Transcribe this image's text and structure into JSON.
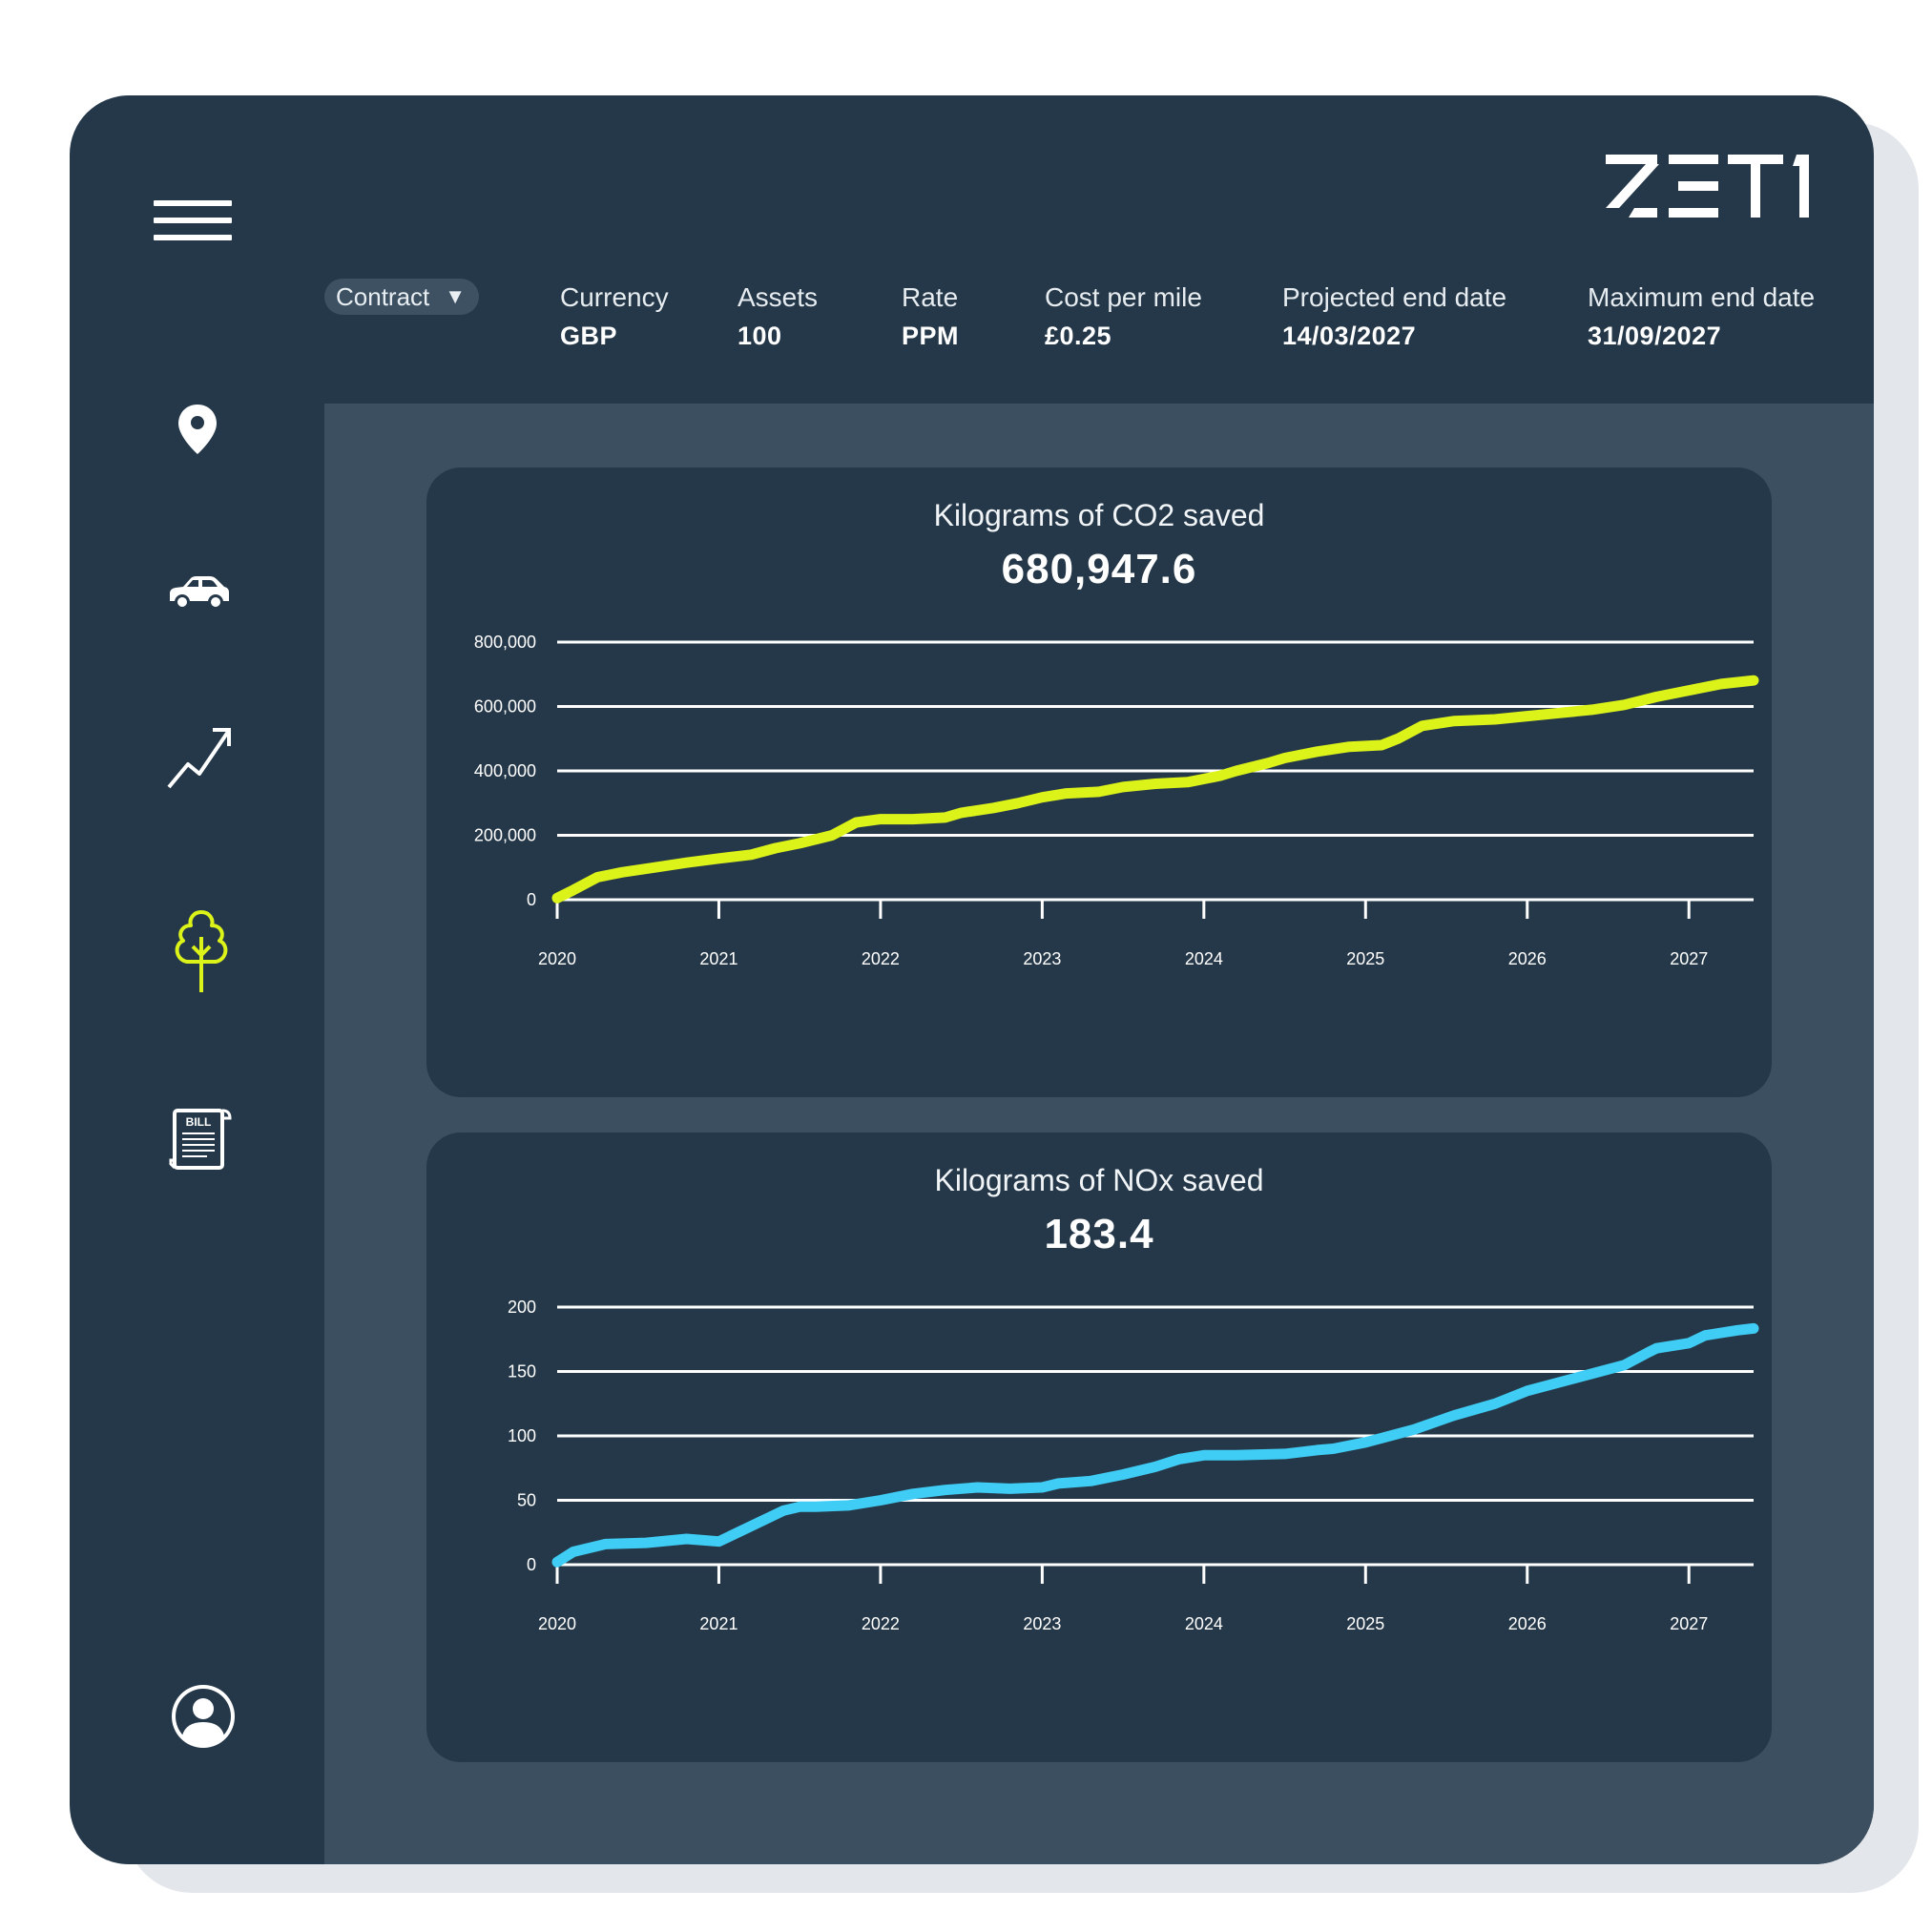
{
  "brand": {
    "logo_text": "ZETI"
  },
  "sidebar": {
    "items": [
      {
        "icon": "location-pin-icon",
        "active": false
      },
      {
        "icon": "car-icon",
        "active": false
      },
      {
        "icon": "trend-up-icon",
        "active": false
      },
      {
        "icon": "tree-icon",
        "active": true
      },
      {
        "icon": "bill-icon",
        "active": false
      }
    ],
    "profile_icon": "user-profile-icon"
  },
  "header": {
    "contract_dropdown": {
      "label": "Contract"
    },
    "stats": [
      {
        "label": "Currency",
        "value": "GBP"
      },
      {
        "label": "Assets",
        "value": "100"
      },
      {
        "label": "Rate",
        "value": "PPM"
      },
      {
        "label": "Cost per mile",
        "value": "£0.25"
      },
      {
        "label": "Projected end date",
        "value": "14/03/2027"
      },
      {
        "label": "Maximum end date",
        "value": "31/09/2027"
      }
    ]
  },
  "colors": {
    "background": "#253849",
    "content": "#3b4f60",
    "co2_line": "#dcf31a",
    "nox_line": "#3fcdf5"
  },
  "chart_data": [
    {
      "type": "line",
      "title": "Kilograms of CO2 saved",
      "total": "680,947.6",
      "x_ticks": [
        "2020",
        "2021",
        "2022",
        "2023",
        "2024",
        "2025",
        "2026",
        "2027"
      ],
      "y_ticks": [
        "0",
        "200,000",
        "400,000",
        "600,000",
        "800,000"
      ],
      "ylim": [
        0,
        800000
      ],
      "xlim": [
        2020,
        2027.4
      ],
      "grid": true,
      "series": [
        {
          "color": "#dcf31a",
          "x": [
            2020.0,
            2020.1,
            2020.25,
            2020.4,
            2020.6,
            2020.8,
            2021.0,
            2021.2,
            2021.35,
            2021.5,
            2021.7,
            2021.85,
            2022.0,
            2022.2,
            2022.4,
            2022.5,
            2022.7,
            2022.85,
            2023.0,
            2023.15,
            2023.35,
            2023.5,
            2023.7,
            2023.9,
            2024.1,
            2024.2,
            2024.4,
            2024.5,
            2024.7,
            2024.9,
            2025.1,
            2025.2,
            2025.35,
            2025.55,
            2025.8,
            2026.0,
            2026.2,
            2026.4,
            2026.6,
            2026.8,
            2027.0,
            2027.2,
            2027.4
          ],
          "y": [
            5000,
            30000,
            70000,
            85000,
            100000,
            115000,
            128000,
            140000,
            160000,
            175000,
            200000,
            240000,
            250000,
            250000,
            255000,
            270000,
            285000,
            300000,
            318000,
            330000,
            335000,
            350000,
            360000,
            365000,
            385000,
            400000,
            425000,
            440000,
            460000,
            475000,
            480000,
            500000,
            540000,
            555000,
            560000,
            570000,
            580000,
            590000,
            605000,
            630000,
            650000,
            670000,
            680948
          ]
        }
      ]
    },
    {
      "type": "line",
      "title": "Kilograms of NOx saved",
      "total": "183.4",
      "x_ticks": [
        "2020",
        "2021",
        "2022",
        "2023",
        "2024",
        "2025",
        "2026",
        "2027"
      ],
      "y_ticks": [
        "0",
        "50",
        "100",
        "150",
        "200"
      ],
      "ylim": [
        0,
        200
      ],
      "xlim": [
        2020,
        2027.4
      ],
      "grid": true,
      "series": [
        {
          "color": "#3fcdf5",
          "x": [
            2020.0,
            2020.1,
            2020.3,
            2020.55,
            2020.8,
            2021.0,
            2021.2,
            2021.4,
            2021.5,
            2021.6,
            2021.8,
            2022.0,
            2022.2,
            2022.4,
            2022.6,
            2022.8,
            2023.0,
            2023.1,
            2023.3,
            2023.5,
            2023.7,
            2023.85,
            2024.0,
            2024.2,
            2024.5,
            2024.7,
            2024.8,
            2025.0,
            2025.3,
            2025.55,
            2025.8,
            2026.0,
            2026.3,
            2026.6,
            2026.75,
            2026.8,
            2027.0,
            2027.1,
            2027.2,
            2027.3,
            2027.4
          ],
          "y": [
            2,
            10,
            16,
            17,
            20,
            18,
            30,
            42,
            45,
            45,
            46,
            50,
            55,
            58,
            60,
            59,
            60,
            63,
            65,
            70,
            76,
            82,
            85,
            85,
            86,
            89,
            90,
            95,
            105,
            116,
            125,
            135,
            145,
            155,
            165,
            168,
            172,
            178,
            180,
            182,
            183.4
          ]
        }
      ]
    }
  ]
}
